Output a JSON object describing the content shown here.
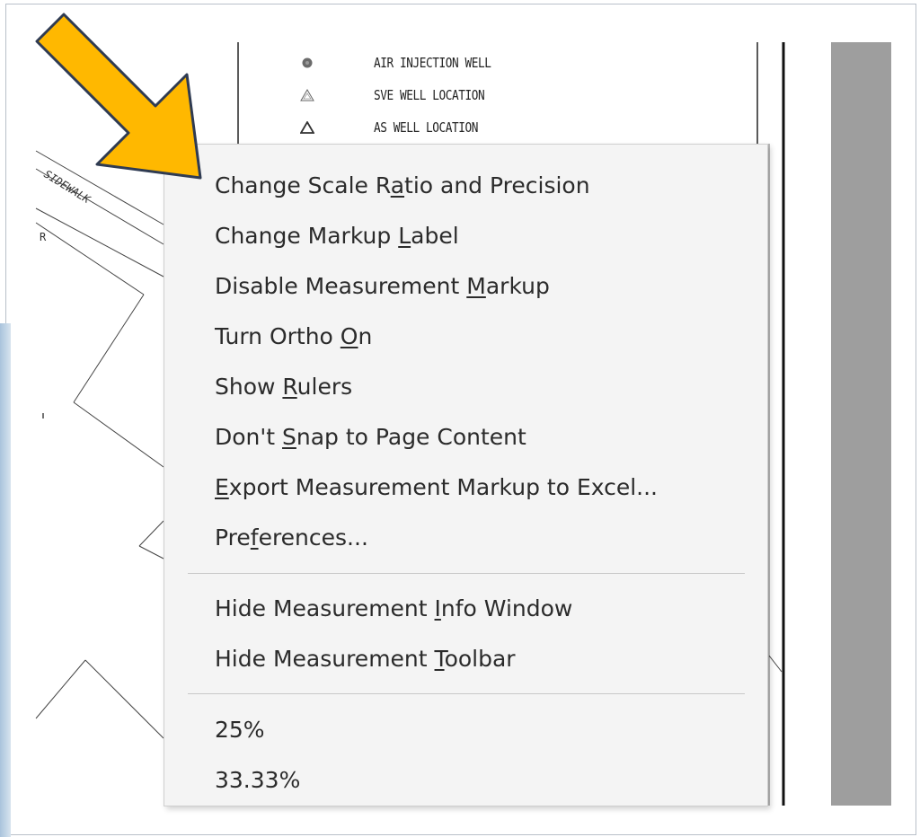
{
  "legend": [
    {
      "icon": "filled-circle-icon",
      "label": "AIR INJECTION WELL"
    },
    {
      "icon": "triangle-outline-icon",
      "label": "SVE WELL LOCATION"
    },
    {
      "icon": "triangle-outline-bold-icon",
      "label": "AS WELL LOCATION"
    }
  ],
  "drawing": {
    "sidewalk_label": "SIDEWALK",
    "edge_letter": "R"
  },
  "context_menu": {
    "items": [
      {
        "pre": "Change Scale R",
        "key": "a",
        "post": "tio and Precision"
      },
      {
        "pre": "Change Markup ",
        "key": "L",
        "post": "abel"
      },
      {
        "pre": "Disable Measurement ",
        "key": "M",
        "post": "arkup"
      },
      {
        "pre": "Turn Ortho ",
        "key": "O",
        "post": "n"
      },
      {
        "pre": "Show ",
        "key": "R",
        "post": "ulers"
      },
      {
        "pre": "Don't ",
        "key": "S",
        "post": "nap to Page Content"
      },
      {
        "pre": "",
        "key": "E",
        "post": "xport Measurement Markup to Excel..."
      },
      {
        "pre": "Pre",
        "key": "f",
        "post": "erences..."
      },
      {
        "pre": "Hide Measurement ",
        "key": "I",
        "post": "nfo Window"
      },
      {
        "pre": "Hide Measurement ",
        "key": "T",
        "post": "oolbar"
      },
      {
        "pre": "25%",
        "key": "",
        "post": ""
      },
      {
        "pre": "33.33%",
        "key": "",
        "post": ""
      }
    ]
  },
  "annotation": {
    "icon": "callout-arrow-icon",
    "color": "#ffb800",
    "outline": "#2f3b52"
  }
}
